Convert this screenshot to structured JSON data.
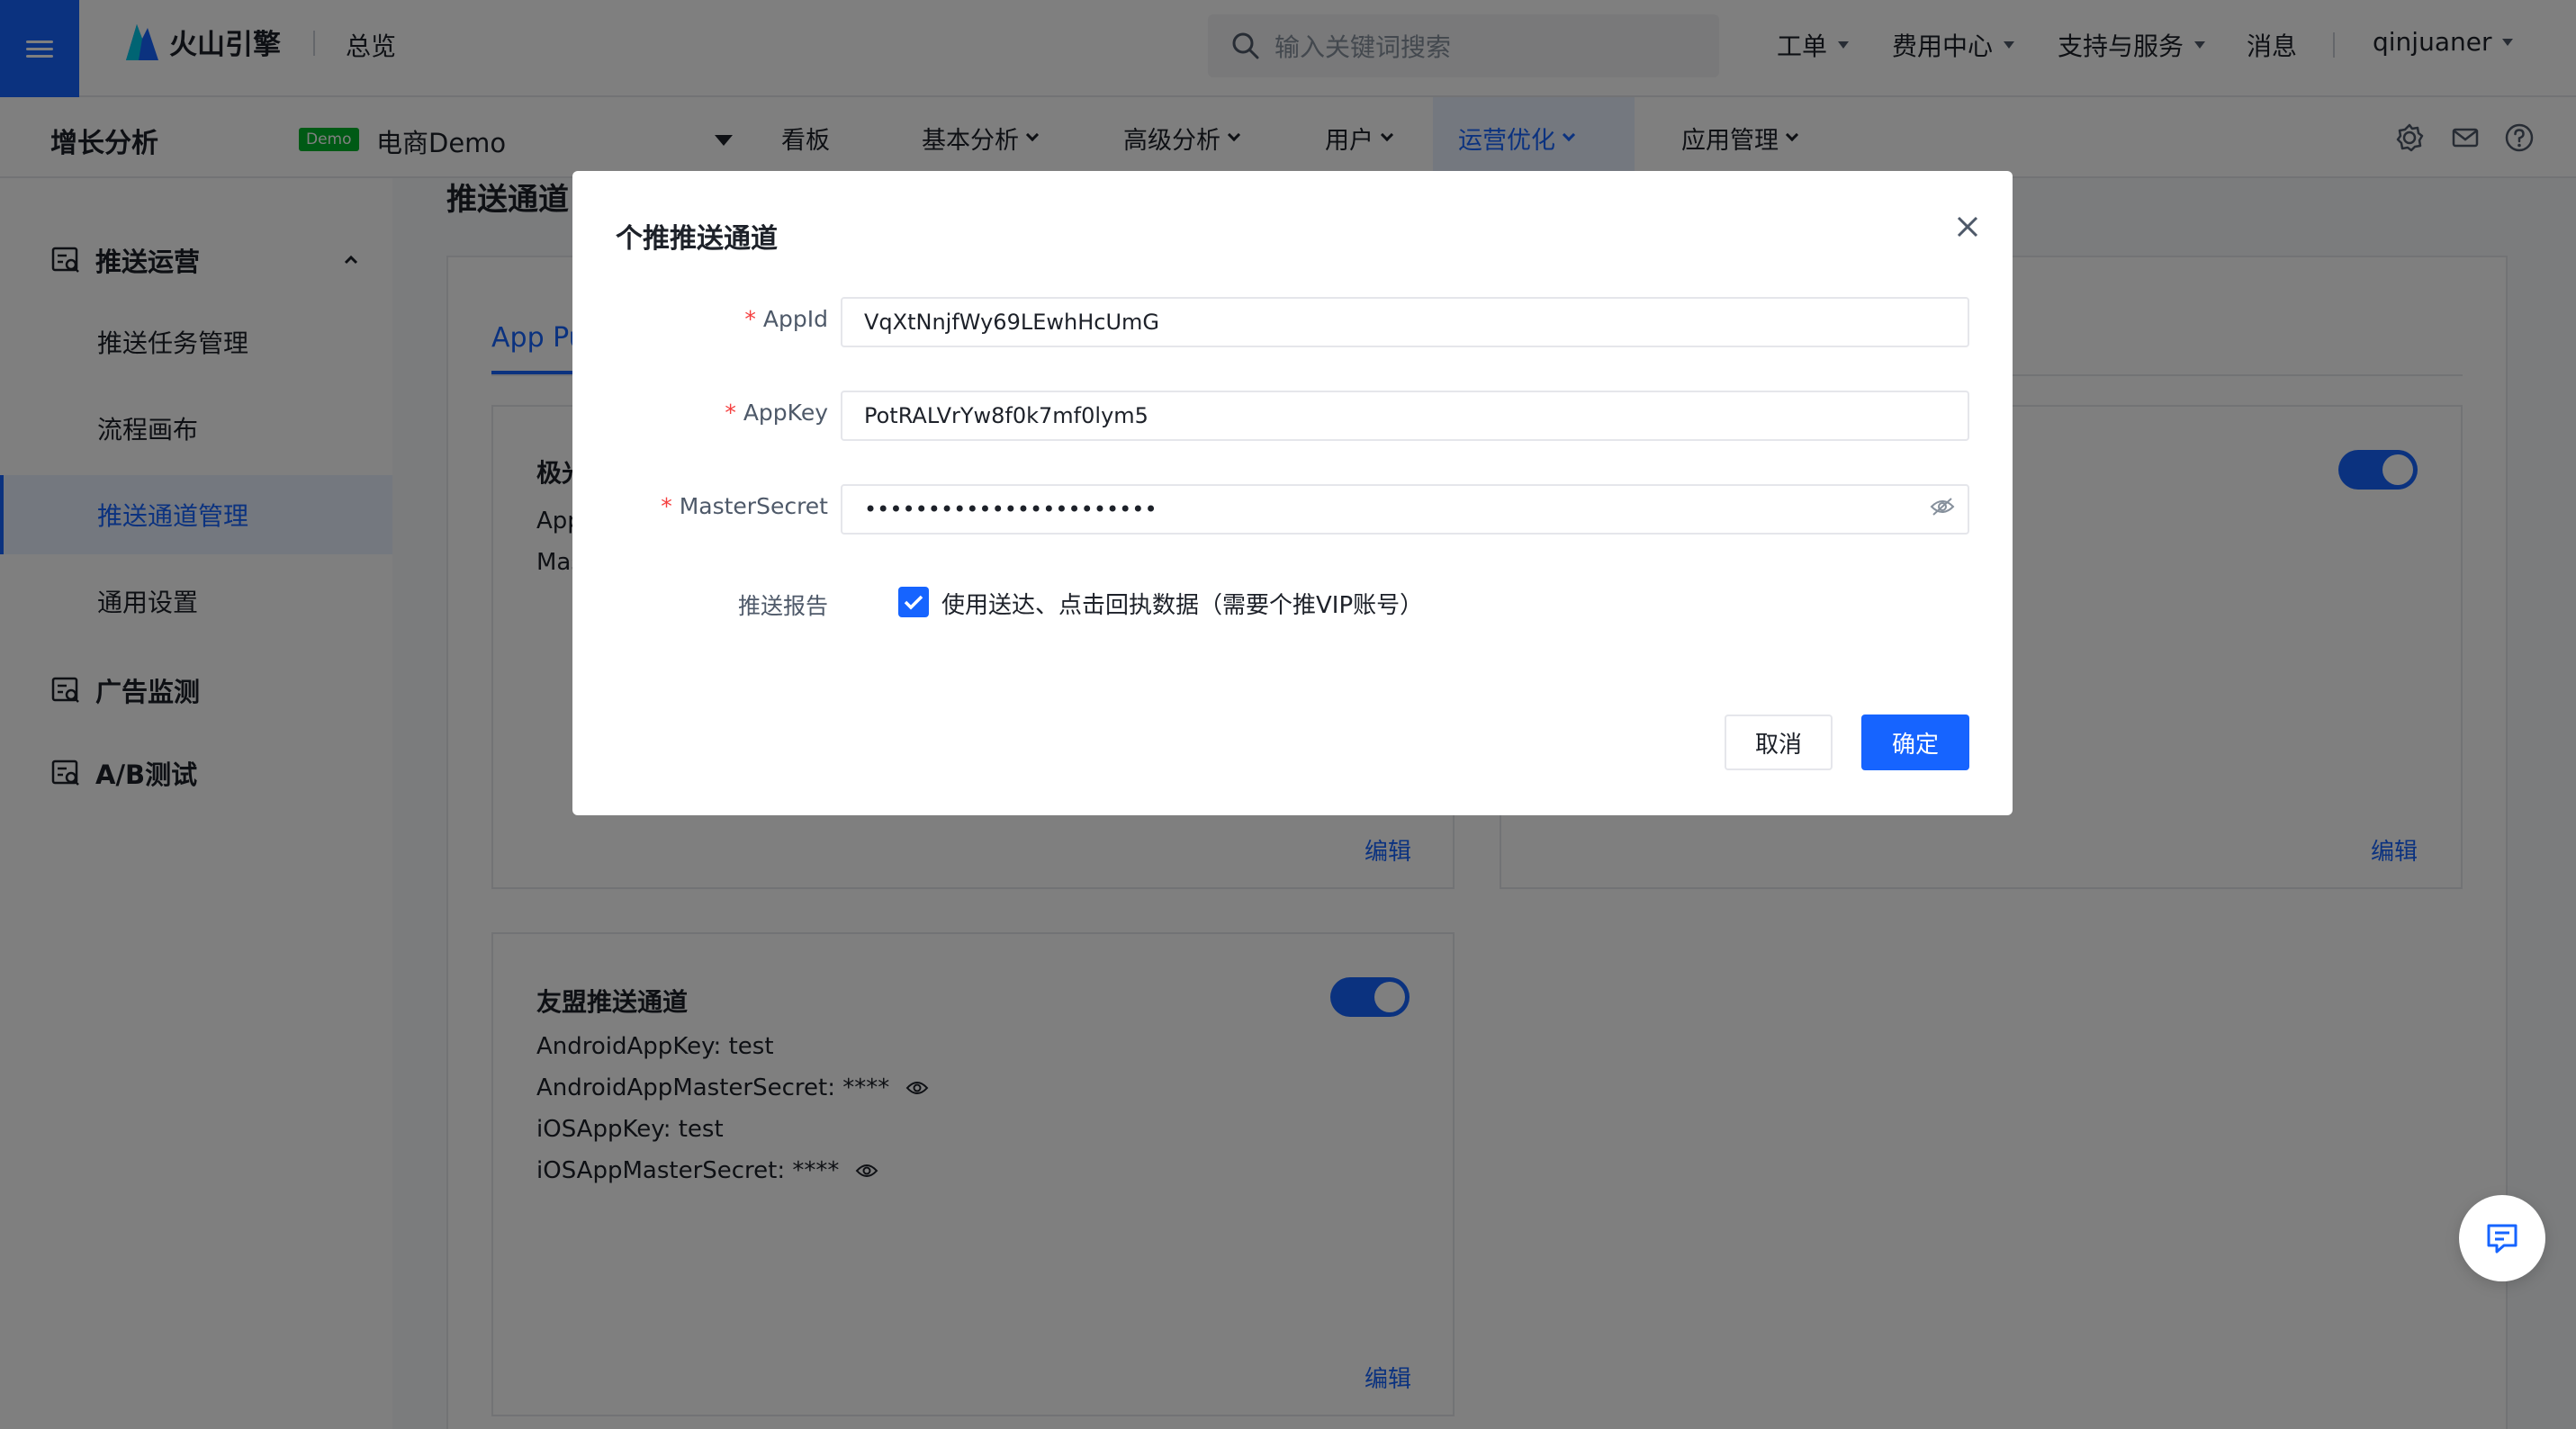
{
  "topbar": {
    "logo_text": "火山引擎",
    "overview": "总览",
    "search_placeholder": "输入关键词搜索",
    "nav": [
      "工单",
      "费用中心",
      "支持与服务",
      "消息"
    ],
    "user": "qinjuaner"
  },
  "subnav": {
    "app_title": "增长分析",
    "demo_badge": "Demo",
    "project": "电商Demo",
    "tabs": [
      "看板",
      "基本分析",
      "高级分析",
      "用户",
      "运营优化",
      "应用管理"
    ],
    "active_tab": "运营优化"
  },
  "sidebar": {
    "group_push": "推送运营",
    "items": [
      "推送任务管理",
      "流程画布",
      "推送通道管理",
      "通用设置"
    ],
    "active_item": "推送通道管理",
    "group_ads": "广告监测",
    "group_ab": "A/B测试"
  },
  "content": {
    "page_heading": "推送通道",
    "tab_label": "App Pu",
    "card1": {
      "title": "极光",
      "line1": "App",
      "line2": "Mas",
      "edit": "编辑"
    },
    "card2": {
      "edit": "编辑"
    },
    "card3": {
      "title": "友盟推送通道",
      "lines": [
        "AndroidAppKey: test",
        "AndroidAppMasterSecret: ****",
        "iOSAppKey: test",
        "iOSAppMasterSecret: ****"
      ],
      "edit": "编辑"
    }
  },
  "modal": {
    "title": "个推推送通道",
    "fields": [
      {
        "label": "AppId",
        "value": "VqXtNnjfWy69LEwhHcUmG"
      },
      {
        "label": "AppKey",
        "value": "PotRALVrYw8f0k7mf0lym5"
      },
      {
        "label": "MasterSecret",
        "value": "•••••••••••••••••••••••"
      }
    ],
    "required_mark": "*",
    "report_label": "推送报告",
    "report_checkbox": "使用送达、点击回执数据（需要个推VIP账号）",
    "cancel": "取消",
    "ok": "确定"
  },
  "colors": {
    "primary": "#1664ff",
    "badge": "#00b42a",
    "required": "#f53f3f"
  },
  "icons": [
    "menu-icon",
    "search-icon",
    "settings-icon",
    "mail-icon",
    "help-icon",
    "close-icon",
    "eye-off-icon",
    "eye-icon",
    "chat-icon"
  ]
}
